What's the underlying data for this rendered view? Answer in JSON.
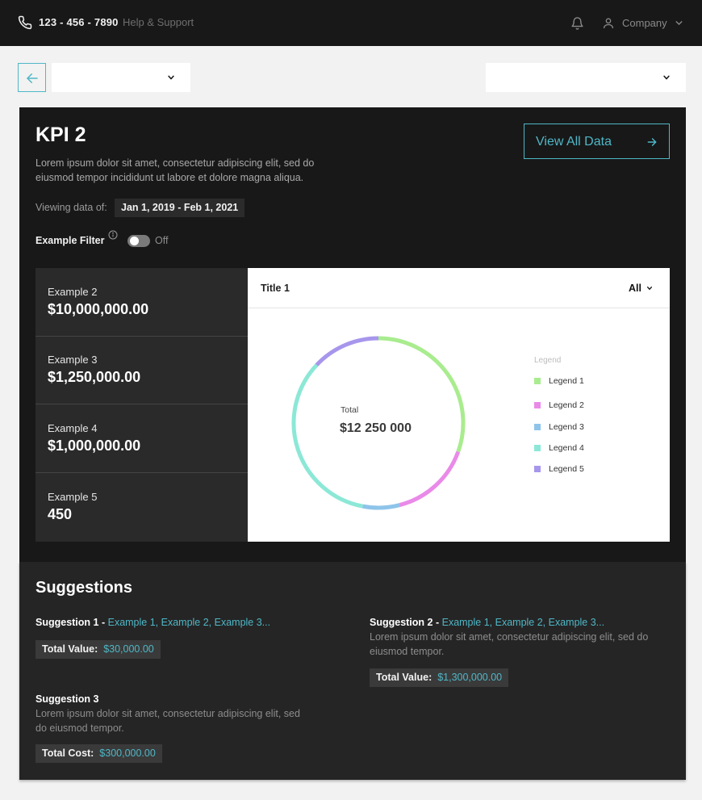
{
  "topbar": {
    "phone": "123 - 456 - 7890",
    "help": "Help & Support",
    "company": "Company"
  },
  "kpi": {
    "title": "KPI 2",
    "description": "Lorem ipsum dolor sit amet, consectetur adipiscing elit, sed do eiusmod tempor incididunt ut labore et dolore magna aliqua.",
    "view_all": "View All Data",
    "viewing_label": "Viewing data of:",
    "date_range": "Jan 1, 2019 - Feb 1, 2021",
    "filter_label": "Example Filter",
    "toggle_state": "Off"
  },
  "stats": [
    {
      "label": "Example 2",
      "value": "$10,000,000.00"
    },
    {
      "label": "Example 3",
      "value": "$1,250,000.00"
    },
    {
      "label": "Example 4",
      "value": "$1,000,000.00"
    },
    {
      "label": "Example 5",
      "value": "450"
    }
  ],
  "chart_panel": {
    "title": "Title 1",
    "filter": "All",
    "total_label": "Total",
    "total_value": "$12 250 000",
    "legend_title": "Legend"
  },
  "chart_data": {
    "type": "pie",
    "categories": [
      "Legend 1",
      "Legend 2",
      "Legend 3",
      "Legend 4",
      "Legend 5"
    ],
    "values": [
      30.5,
      15.5,
      7,
      34,
      13
    ],
    "colors": [
      "#a9ec8f",
      "#e98ae8",
      "#8ec4ea",
      "#8ce8d6",
      "#a796ec"
    ]
  },
  "suggestions": {
    "title": "Suggestions",
    "items": [
      {
        "name": "Suggestion 1 -",
        "examples": "Example 1, Example 2, Example 3...",
        "value_label": "Total Value:",
        "value": "$30,000.00"
      },
      {
        "name": "Suggestion 2 -",
        "examples": "Example 1, Example 2, Example 3...",
        "description": "Lorem ipsum dolor sit amet, consectetur adipiscing elit, sed do eiusmod tempor.",
        "value_label": "Total Value:",
        "value": "$1,300,000.00"
      },
      {
        "name": "Suggestion 3",
        "description": "Lorem ipsum dolor sit amet, consectetur adipiscing elit, sed do eiusmod tempor.",
        "value_label": "Total Cost:",
        "value": "$300,000.00"
      }
    ]
  },
  "colors": {
    "accent": "#4fb7c7",
    "topbar_bg": "#181818",
    "card_bg": "#181818",
    "suggestions_bg": "#252525"
  }
}
